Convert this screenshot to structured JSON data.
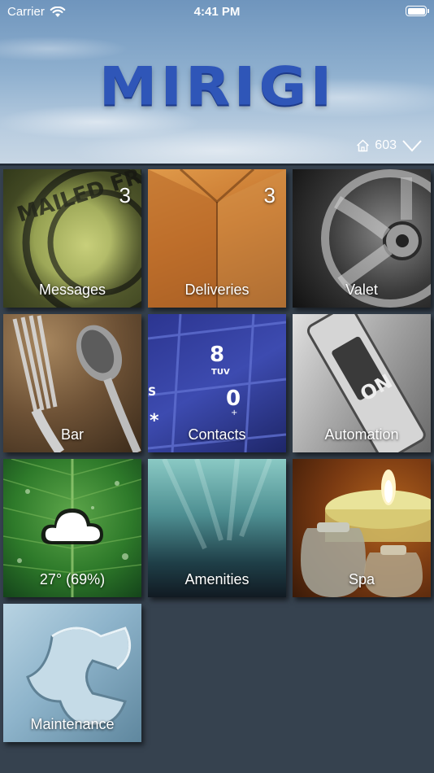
{
  "status_bar": {
    "carrier": "Carrier",
    "time": "4:41 PM"
  },
  "header": {
    "logo": "MIRIGI",
    "unit": "603"
  },
  "tiles": [
    {
      "label": "Messages",
      "badge": "3",
      "icon": "mail-stamp-image"
    },
    {
      "label": "Deliveries",
      "badge": "3",
      "icon": "cardboard-box-image"
    },
    {
      "label": "Valet",
      "badge": "",
      "icon": "car-wheel-image"
    },
    {
      "label": "Bar",
      "badge": "",
      "icon": "fork-spoon-image"
    },
    {
      "label": "Contacts",
      "badge": "",
      "icon": "phone-keypad-image"
    },
    {
      "label": "Automation",
      "badge": "",
      "icon": "switch-image"
    },
    {
      "label": "27° (69%)",
      "badge": "",
      "icon": "cloud-weather-icon"
    },
    {
      "label": "Amenities",
      "badge": "",
      "icon": "aurora-image"
    },
    {
      "label": "Spa",
      "badge": "",
      "icon": "candle-image"
    },
    {
      "label": "Maintenance",
      "badge": "",
      "icon": "wrench-image"
    }
  ],
  "colors": {
    "background": "#36424f",
    "logo_blue": "#2f56b8"
  }
}
